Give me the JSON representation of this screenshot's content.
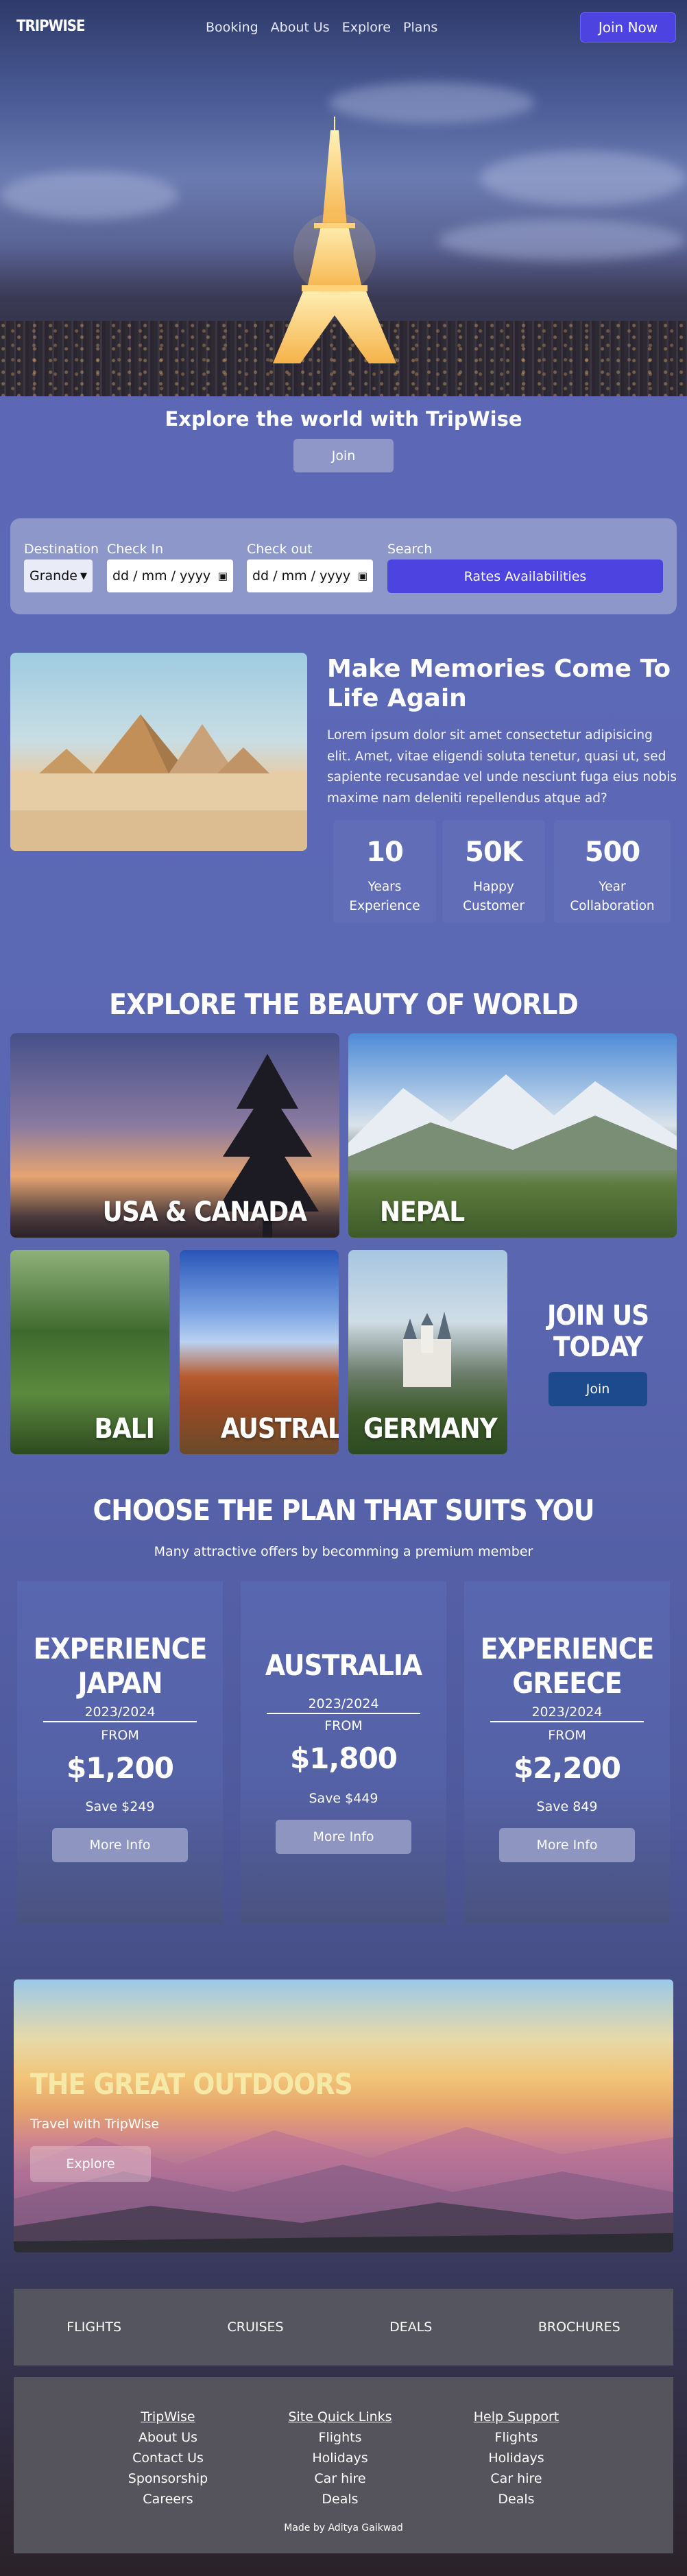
{
  "nav": {
    "logo": "TRIPWISE",
    "links": [
      "Booking",
      "About Us",
      "Explore",
      "Plans"
    ],
    "cta": "Join Now"
  },
  "hero": {
    "title": "Explore the world with TripWise",
    "join": "Join"
  },
  "search": {
    "destination_label": "Destination",
    "destination_value": "Grande",
    "checkin_label": "Check In",
    "checkin_placeholder": "dd / mm / yyyy",
    "checkout_label": "Check out",
    "checkout_placeholder": "dd / mm / yyyy",
    "search_label": "Search",
    "button": "Rates Availabilities"
  },
  "memories": {
    "title": "Make Memories Come To Life Again",
    "text": "Lorem ipsum dolor sit amet consectetur adipisicing elit. Amet, vitae eligendi soluta tenetur, quasi ut, sed sapiente recusandae vel unde nesciunt fuga eius nobis maxime nam deleniti repellendus atque ad?",
    "stats": [
      {
        "number": "10",
        "label1": "Years",
        "label2": "Experience"
      },
      {
        "number": "50K",
        "label1": "Happy",
        "label2": "Customer"
      },
      {
        "number": "500",
        "label1": "Year",
        "label2": "Collaboration"
      }
    ]
  },
  "explore": {
    "title": "EXPLORE THE BEAUTY OF WORLD",
    "destinations": [
      "USA & CANADA",
      "NEPAL",
      "BALI",
      "AUSTRALIA",
      "GERMANY"
    ],
    "join_title": "JOIN US TODAY",
    "join_button": "Join"
  },
  "plans": {
    "title": "CHOOSE THE PLAN THAT SUITS YOU",
    "subtitle": "Many attractive offers by becomming a premium member",
    "items": [
      {
        "line1": "EXPERIENCE",
        "line2": "JAPAN",
        "year": "2023/2024",
        "from": "FROM",
        "price": "$1,200",
        "save": "Save $249",
        "button": "More Info"
      },
      {
        "line1": "AUSTRALIA",
        "line2": "",
        "year": "2023/2024",
        "from": "FROM",
        "price": "$1,800",
        "save": "Save $449",
        "button": "More Info"
      },
      {
        "line1": "EXPERIENCE",
        "line2": "GREECE",
        "year": "2023/2024",
        "from": "FROM",
        "price": "$2,200",
        "save": "Save 849",
        "button": "More Info"
      }
    ]
  },
  "outdoors": {
    "title": "THE GREAT OUTDOORS",
    "subtitle": "Travel with TripWise",
    "button": "Explore"
  },
  "footer": {
    "bar": [
      "FLIGHTS",
      "CRUISES",
      "DEALS",
      "BROCHURES"
    ],
    "columns": [
      {
        "heading": "TripWise",
        "items": [
          "About Us",
          "Contact Us",
          "Sponsorship",
          "Careers"
        ]
      },
      {
        "heading": "Site Quick Links",
        "items": [
          "Flights",
          "Holidays",
          "Car hire",
          "Deals"
        ]
      },
      {
        "heading": "Help Support",
        "items": [
          "Flights",
          "Holidays",
          "Car hire",
          "Deals"
        ]
      }
    ],
    "credit": "Made by Aditya Gaikwad"
  }
}
